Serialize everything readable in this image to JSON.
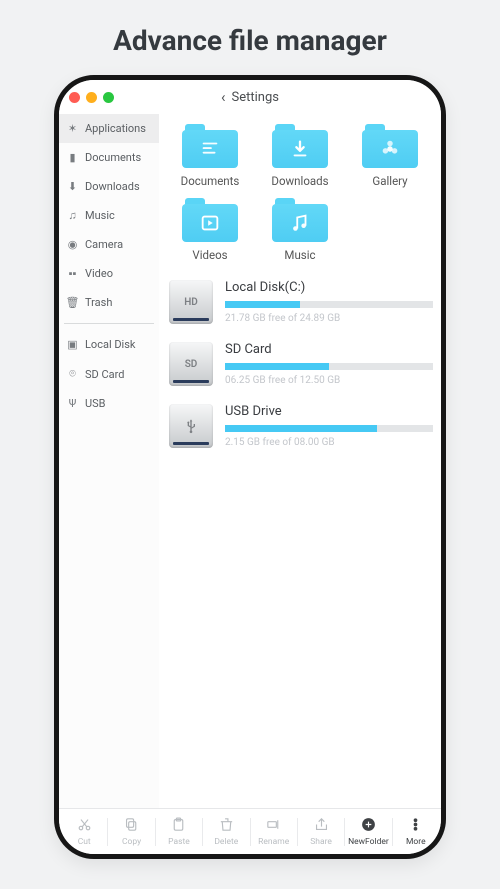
{
  "pageTitle": "Advance file manager",
  "header": {
    "back": "‹",
    "title": "Settings"
  },
  "sidebar": {
    "groupA": [
      {
        "icon": "apps",
        "label": "Applications",
        "active": true
      },
      {
        "icon": "doc",
        "label": "Documents"
      },
      {
        "icon": "download",
        "label": "Downloads"
      },
      {
        "icon": "music",
        "label": "Music"
      },
      {
        "icon": "camera",
        "label": "Camera"
      },
      {
        "icon": "video",
        "label": "Video"
      },
      {
        "icon": "trash",
        "label": "Trash"
      }
    ],
    "groupB": [
      {
        "icon": "disk",
        "label": "Local Disk"
      },
      {
        "icon": "sd",
        "label": "SD Card"
      },
      {
        "icon": "usb",
        "label": "USB"
      }
    ]
  },
  "folders": [
    {
      "label": "Documents",
      "glyph": "doc"
    },
    {
      "label": "Downloads",
      "glyph": "down"
    },
    {
      "label": "Gallery",
      "glyph": "flower"
    },
    {
      "label": "Videos",
      "glyph": "play"
    },
    {
      "label": "Music",
      "glyph": "note"
    }
  ],
  "drives": [
    {
      "badge": "HD",
      "name": "Local Disk(C:)",
      "free": "21.78 GB free of 24.89 GB",
      "pct": 36
    },
    {
      "badge": "SD",
      "name": "SD Card",
      "free": "06.25 GB free of 12.50 GB",
      "pct": 50
    },
    {
      "badge": "⬆",
      "name": "USB Drive",
      "free": "2.15 GB free of 08.00 GB",
      "pct": 73,
      "usb": true
    }
  ],
  "toolbar": [
    {
      "label": "Cut",
      "icon": "cut"
    },
    {
      "label": "Copy",
      "icon": "copy"
    },
    {
      "label": "Paste",
      "icon": "paste"
    },
    {
      "label": "Delete",
      "icon": "delete"
    },
    {
      "label": "Rename",
      "icon": "rename"
    },
    {
      "label": "Share",
      "icon": "share"
    },
    {
      "label": "NewFolder",
      "icon": "new",
      "dark": true
    },
    {
      "label": "More",
      "icon": "more",
      "dark": true
    }
  ]
}
